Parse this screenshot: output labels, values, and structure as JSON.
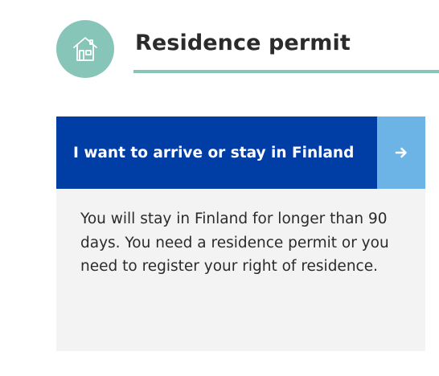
{
  "header": {
    "icon": "house-icon",
    "title": "Residence permit"
  },
  "card": {
    "link_label": "I want to arrive or stay in Finland",
    "link_icon": "arrow-right-icon",
    "description": "You will stay in Finland for longer than 90 days. You need a residence permit or you need to register your right of residence."
  },
  "colors": {
    "accent_teal": "#86c5b8",
    "link_blue": "#003da5",
    "arrow_blue": "#6cb4e6",
    "card_bg": "#f3f3f3",
    "text_dark": "#2b2b2b"
  }
}
